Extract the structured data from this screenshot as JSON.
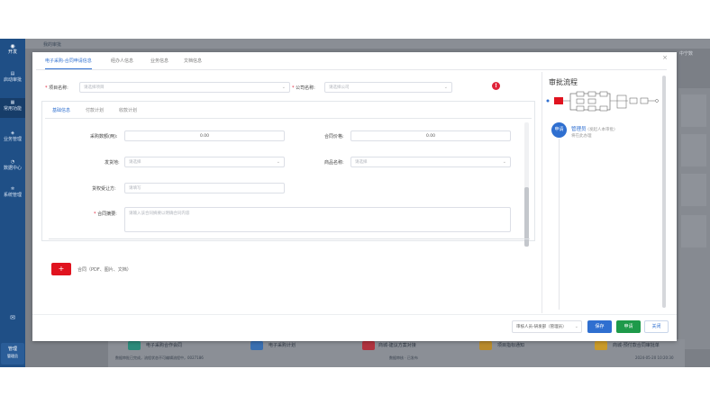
{
  "nav": {
    "logo": "开发",
    "items": [
      {
        "label": "启动审批",
        "icon": "doc-icon"
      },
      {
        "label": "常用功能",
        "icon": "grid-icon"
      },
      {
        "label": "业务管理",
        "icon": "layers-icon"
      },
      {
        "label": "数据中心",
        "icon": "chart-icon"
      },
      {
        "label": "系统管理",
        "icon": "gear-icon"
      }
    ],
    "user_name": "管理",
    "user_role": "管理员"
  },
  "background": {
    "top_text": "我的审批",
    "top_right": "中宁数",
    "bottom_items": [
      {
        "title": "电子采购合作会同",
        "sub": "数据审批已完成，流程状态不可编辑流程中，0027186"
      },
      {
        "title": "电子采购计划",
        "sub": ""
      },
      {
        "title": "商城-建议方案对接",
        "sub": "数据审核 · 已发布"
      },
      {
        "title": "项目指标通知",
        "sub": ""
      },
      {
        "title": "商城-预付款合同审批单",
        "sub": "2024-05-20 10:20:30"
      }
    ]
  },
  "modal": {
    "tabs": [
      "电子采购-合同申请信息",
      "经办人信息",
      "业务信息",
      "文档信息"
    ],
    "active_tab": 0,
    "project_label": "项目名称:",
    "project_placeholder": "请选择项目",
    "company_label": "公司名称:",
    "company_placeholder": "请选择公司",
    "alert_icon": "!",
    "inner_tabs": [
      "基础信息",
      "付款计划",
      "收款计划"
    ],
    "fields": {
      "purchase_amount_label": "采购数额(两):",
      "purchase_amount_value": "0.00",
      "contract_price_label": "合同价格:",
      "contract_price_value": "0.00",
      "supplier_label": "发货地:",
      "supplier_placeholder": "请选择",
      "goods_label": "商品名称:",
      "goods_placeholder": "请选择",
      "receiver_label": "货权受让方:",
      "receiver_placeholder": "请填写",
      "summary_label": "合同摘要:",
      "summary_placeholder": "请输入该合同摘要以明确合同内容"
    },
    "attachment_text": "合同（PDF、图片、文档）",
    "add_icon": "+",
    "close_icon": "×"
  },
  "approval": {
    "title": "审批流程",
    "avatar_text": "申请",
    "approver_name": "管理员",
    "approver_note": "(发起人本审批)",
    "approver_status": "将在此办理"
  },
  "footer": {
    "user_select": "审核人员-研发部（管理员）",
    "save_label": "保存",
    "apply_label": "申请",
    "close_label": "关闭"
  },
  "colors": {
    "primary": "#2f6fd0",
    "success": "#1e9a4a",
    "danger": "#e0131f",
    "nav": "#1f4f86"
  }
}
